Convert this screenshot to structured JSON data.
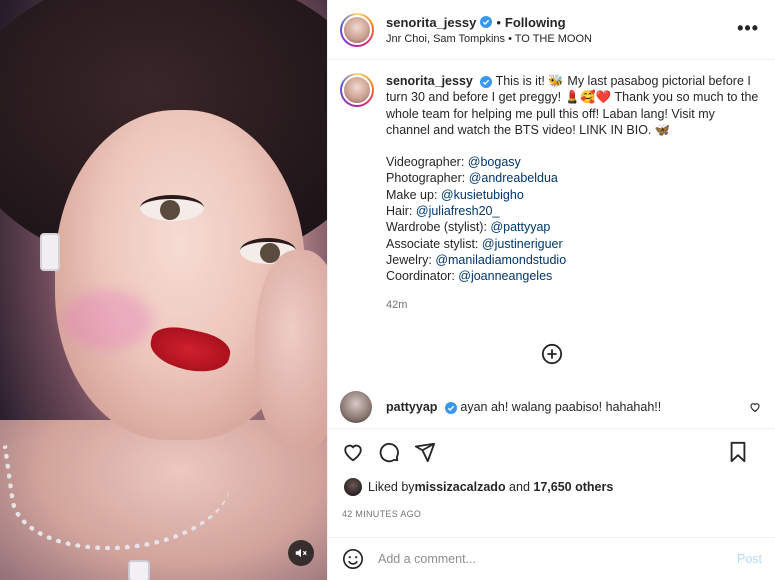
{
  "post": {
    "username": "senorita_jessy",
    "following_label": "Following",
    "audio_line": "Jnr Choi, Sam Tompkins • TO THE MOON",
    "more_label": "•••"
  },
  "caption": {
    "username": "senorita_jessy",
    "line1": "This is it! 🐝 My last pasabog pictorial before I",
    "line2": "turn 30 and before I get preggy! 💄🥰❤️ Thank you so much to the",
    "line3": "whole team for helping me pull this off! Laban lang! Visit my",
    "line4": "channel and watch the BTS video! LINK IN BIO. 🦋",
    "credits": [
      {
        "role": "Videographer: ",
        "handle": "@bogasy"
      },
      {
        "role": "Photographer: ",
        "handle": "@andreabeldua"
      },
      {
        "role": "Make up: ",
        "handle": "@kusietubigho"
      },
      {
        "role": "Hair: ",
        "handle": "@juliafresh20_"
      },
      {
        "role": "Wardrobe (stylist): ",
        "handle": "@pattyyap"
      },
      {
        "role": "Associate stylist: ",
        "handle": "@justineriguer"
      },
      {
        "role": "Jewelry: ",
        "handle": "@maniladiamondstudio"
      },
      {
        "role": "Coordinator: ",
        "handle": "@joanneangeles"
      }
    ],
    "time_ago": "42m"
  },
  "reply": {
    "username": "pattyyap",
    "text": "ayan ah! walang paabiso! hahahah!!"
  },
  "likes": {
    "prefix": "Liked by ",
    "user": "missizacalzado",
    "middle": " and ",
    "others": "17,650 others"
  },
  "timestamp": "42 MINUTES AGO",
  "add_comment": {
    "placeholder": "Add a comment...",
    "post_label": "Post"
  },
  "colors": {
    "link": "#00376b",
    "verified": "#3897f0",
    "post_disabled": "#b3dbff"
  },
  "icons": [
    "verified-badge-icon",
    "more-options-icon",
    "add-circle-icon",
    "heart-icon",
    "comment-icon",
    "share-icon",
    "bookmark-icon",
    "emoji-icon",
    "muted-audio-icon"
  ]
}
